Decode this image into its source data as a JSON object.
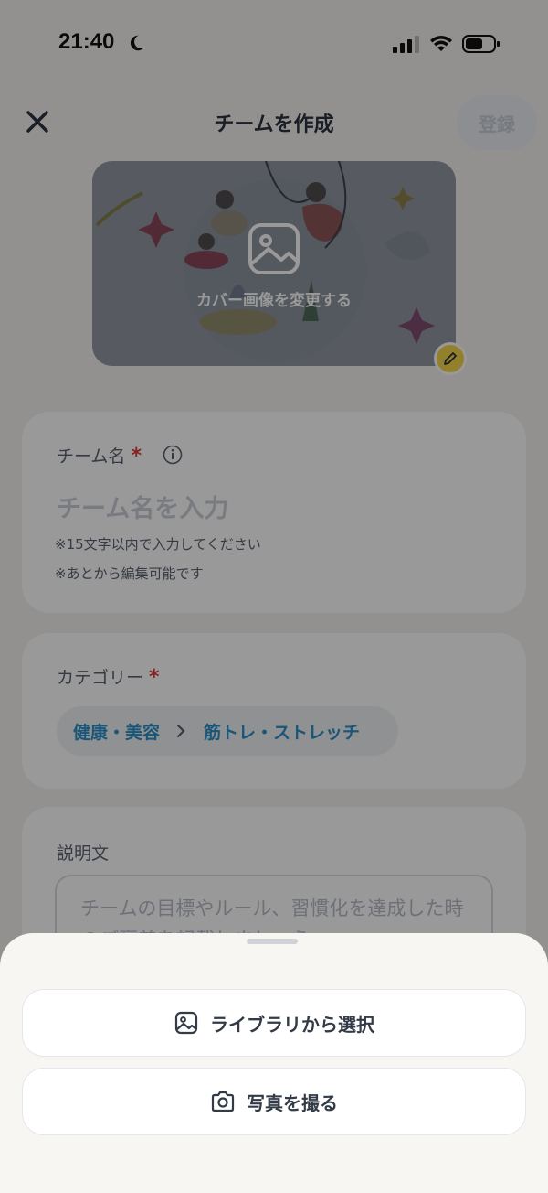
{
  "status_bar": {
    "time": "21:40"
  },
  "header": {
    "title": "チームを作成",
    "register_label": "登録"
  },
  "cover": {
    "change_label": "カバー画像を変更する"
  },
  "team_name": {
    "label": "チーム名",
    "required_mark": "*",
    "placeholder": "チーム名を入力",
    "notes": [
      "※15文字以内で入力してください",
      "※あとから編集可能です"
    ]
  },
  "category": {
    "label": "カテゴリー",
    "required_mark": "*",
    "parent": "健康・美容",
    "child": "筋トレ・ストレッチ"
  },
  "description": {
    "label": "説明文",
    "placeholder": "チームの目標やルール、習慣化を達成した時のご褒美を記載しましょう"
  },
  "sheet": {
    "library_label": "ライブラリから選択",
    "camera_label": "写真を撮る"
  },
  "colors": {
    "accent_blue": "#2a8fc7",
    "required_red": "#e03a3a",
    "badge_yellow": "#f6d54a"
  }
}
